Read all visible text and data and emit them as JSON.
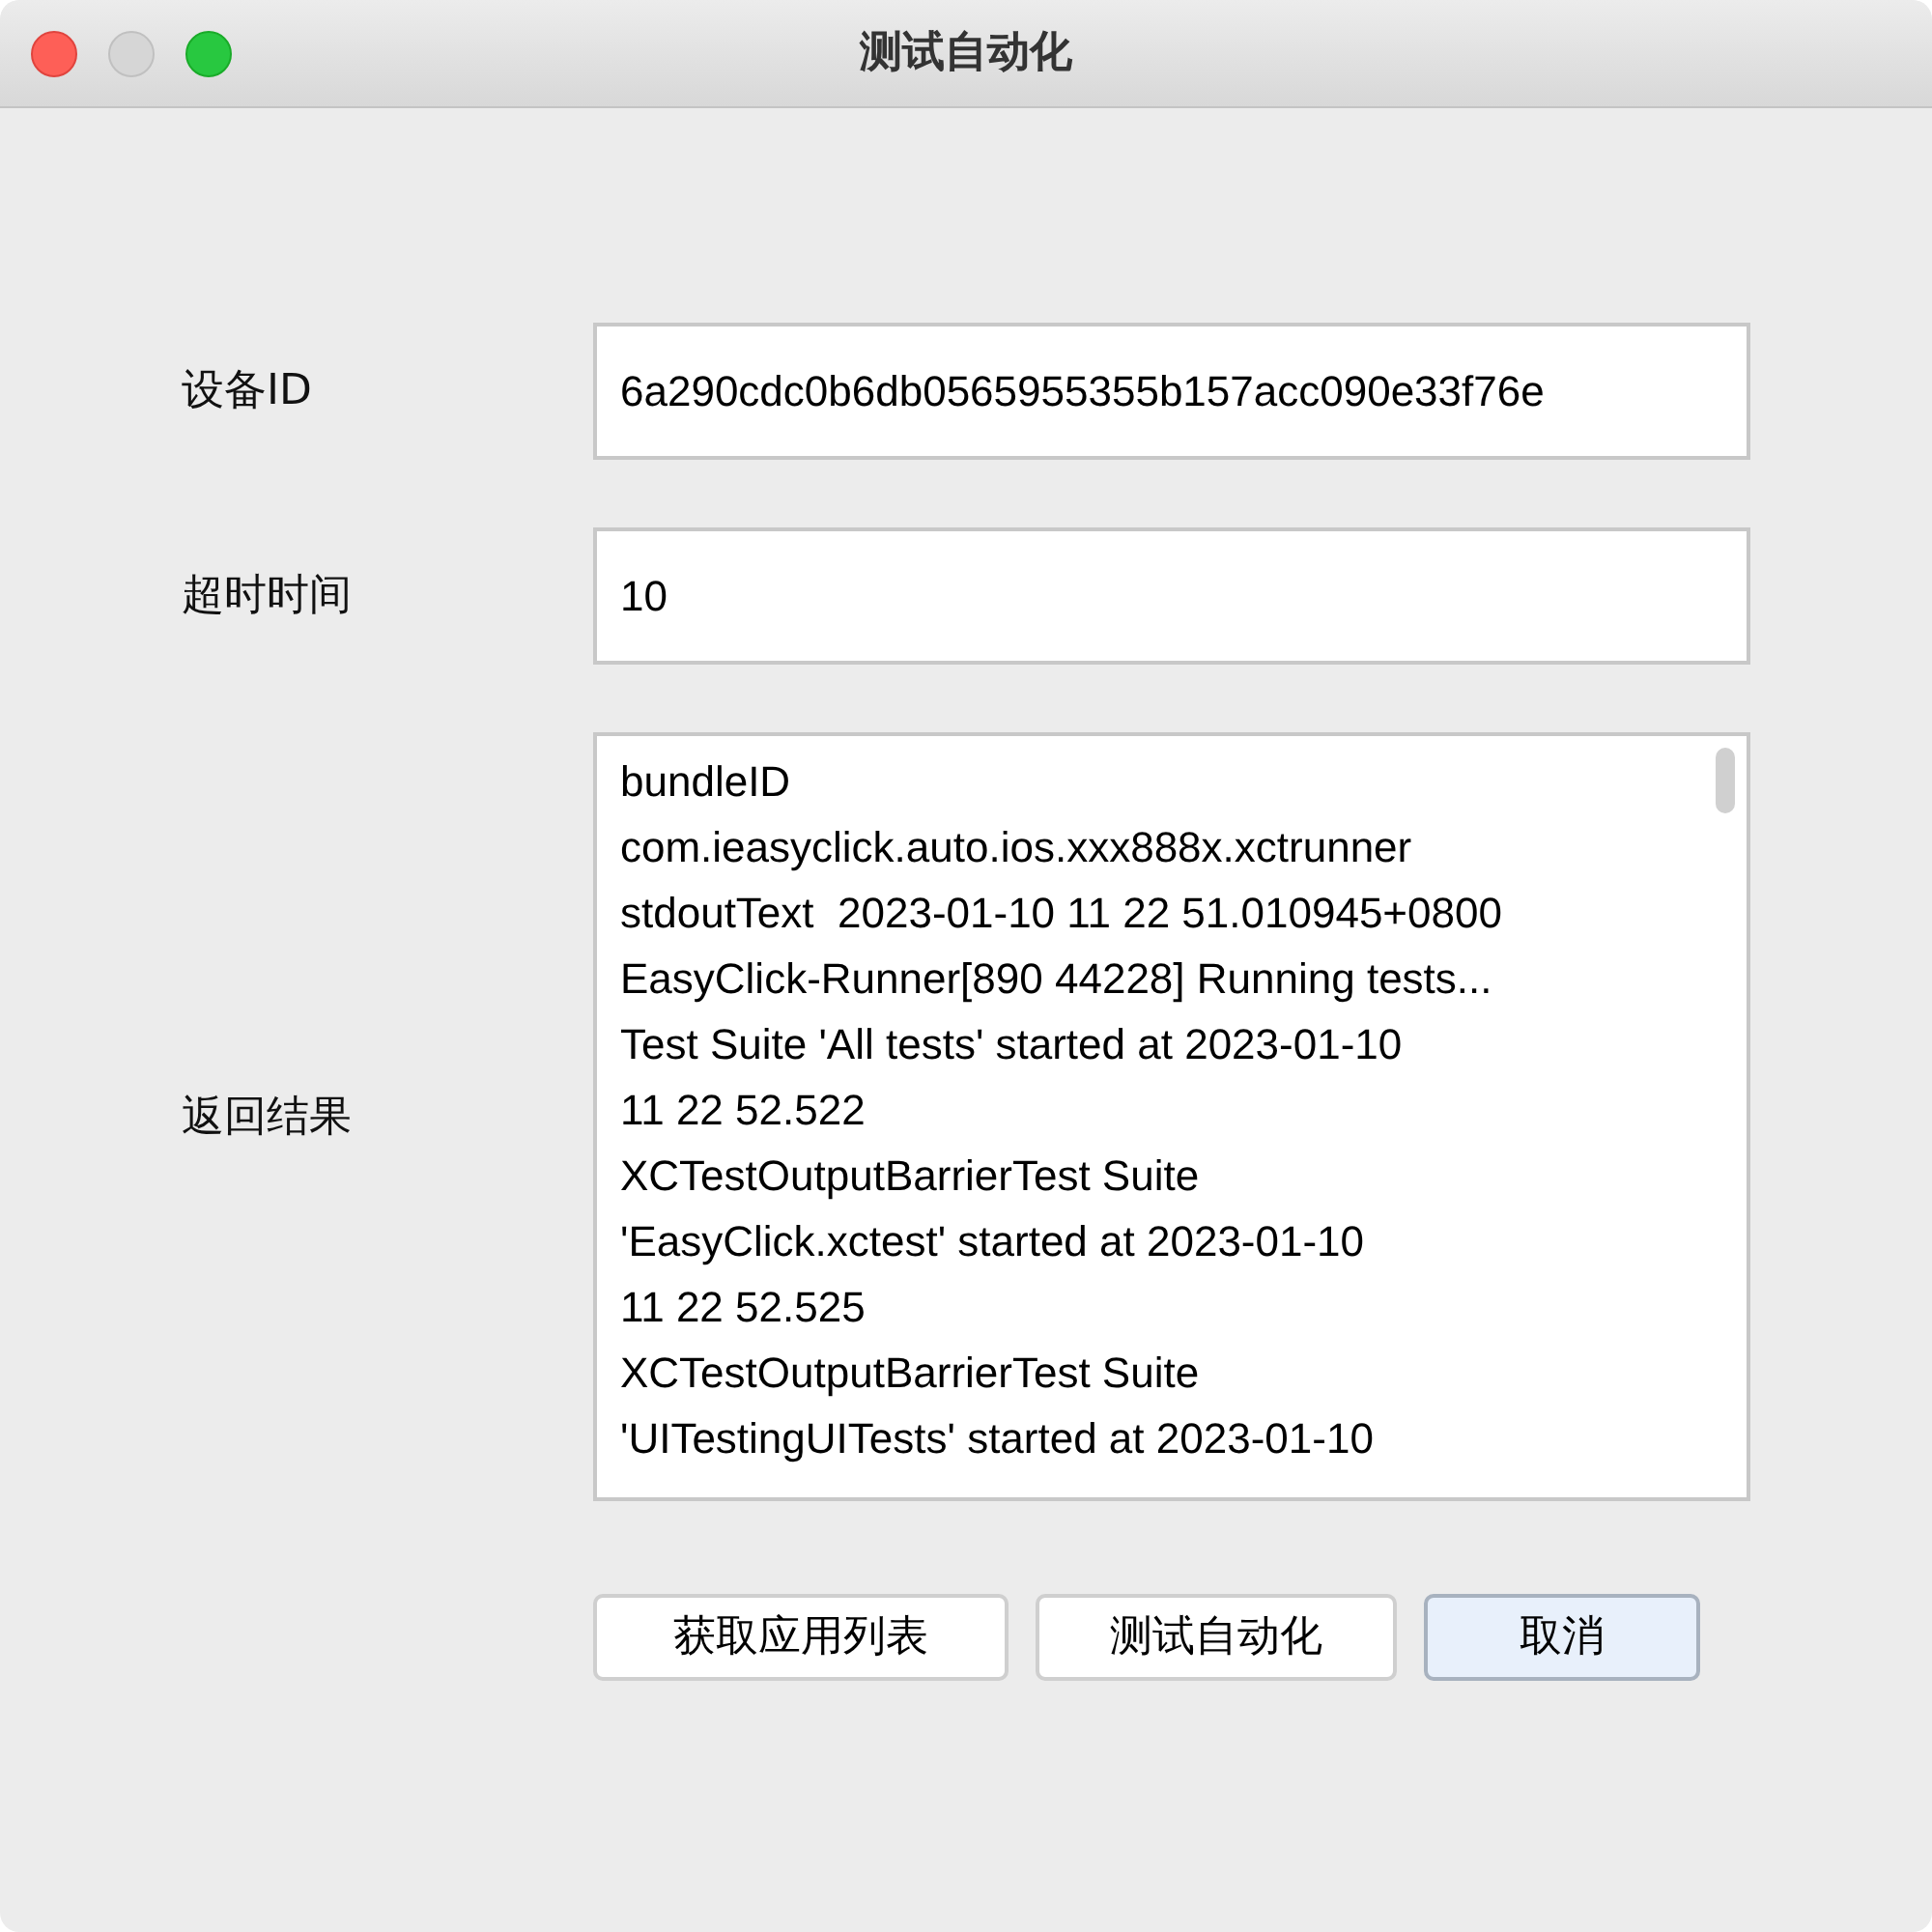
{
  "window": {
    "title": "测试自动化"
  },
  "fields": [
    {
      "label": "设备ID",
      "value": "6a290cdc0b6db0565955355b157acc090e33f76e"
    },
    {
      "label": "超时时间",
      "value": "10"
    }
  ],
  "result": {
    "label": "返回结果",
    "lines": [
      "bundleID",
      "com.ieasyclick.auto.ios.xxx888x.xctrunner",
      "stdoutText  2023-01-10 11 22 51.010945+0800",
      "EasyClick-Runner[890 44228] Running tests...",
      "Test Suite 'All tests' started at 2023-01-10",
      "11 22 52.522",
      "XCTestOutputBarrierTest Suite",
      "'EasyClick.xctest' started at 2023-01-10",
      "11 22 52.525",
      "XCTestOutputBarrierTest Suite",
      "'UITestingUITests' started at 2023-01-10"
    ]
  },
  "buttons": [
    {
      "label": "获取应用列表",
      "default": false
    },
    {
      "label": "测试自动化",
      "default": false
    },
    {
      "label": "取消",
      "default": true
    }
  ]
}
